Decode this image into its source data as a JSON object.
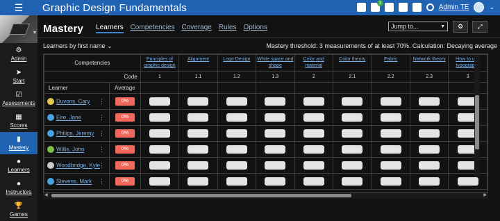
{
  "app": {
    "title": "Graphic Design Fundamentals"
  },
  "topbar": {
    "icons": [
      "mail-icon",
      "bell-icon",
      "calendar-icon",
      "trash-icon",
      "help-icon",
      "search-icon"
    ],
    "notification_count": "3",
    "user_name": "Admin TE",
    "caret": "⌄"
  },
  "sidebar": {
    "items": [
      {
        "label": "Admin",
        "icon": "⚙",
        "name": "admin"
      },
      {
        "label": "Start",
        "icon": "➤",
        "name": "start"
      },
      {
        "label": "Assessments",
        "icon": "☑",
        "name": "assessments"
      },
      {
        "label": "Scores",
        "icon": "▦",
        "name": "scores"
      },
      {
        "label": "Mastery",
        "icon": "▮",
        "name": "mastery"
      },
      {
        "label": "Learners",
        "icon": "●",
        "name": "learners"
      },
      {
        "label": "Instructors",
        "icon": "●",
        "name": "instructors"
      },
      {
        "label": "Games",
        "icon": "🏆",
        "name": "games"
      }
    ],
    "active": "Mastery"
  },
  "page": {
    "title": "Mastery",
    "tabs": [
      "Learners",
      "Competencies",
      "Coverage",
      "Rules",
      "Options"
    ],
    "active_tab": "Learners",
    "jump_to": "Jump to...",
    "learners_by": "Learners by first name",
    "threshold_text": "Mastery threshold: 3 measurements of at least 70%.   Calculation: Decaying average"
  },
  "table": {
    "corner_label": "Competencies",
    "code_label": "Code",
    "learner_header": "Learner",
    "average_header": "Average",
    "competencies": [
      {
        "name": "Principles of graphic design",
        "code": "1"
      },
      {
        "name": "Alignment",
        "code": "1.1"
      },
      {
        "name": "Logo Design",
        "code": "1.2"
      },
      {
        "name": "White space and shape",
        "code": "1.3"
      },
      {
        "name": "Color and material",
        "code": "2"
      },
      {
        "name": "Color theory",
        "code": "2.1"
      },
      {
        "name": "Fabric",
        "code": "2.2"
      },
      {
        "name": "Network theory",
        "code": "2.3"
      },
      {
        "name": "How to use typography",
        "code": "3"
      }
    ],
    "learners": [
      {
        "name": "Duvons, Cary",
        "average": "0%",
        "avatar_color": "#e0c64b"
      },
      {
        "name": "Eire, Jane",
        "average": "0%",
        "avatar_color": "#4aa3df"
      },
      {
        "name": "Philips, Jeremy",
        "average": "0%",
        "avatar_color": "#4aa3df"
      },
      {
        "name": "Willis, John",
        "average": "0%",
        "avatar_color": "#7cc04a"
      },
      {
        "name": "Woodbridge, Kyle",
        "average": "0%",
        "avatar_color": "#c9c9c9"
      },
      {
        "name": "Stevens, Mark",
        "average": "0%",
        "avatar_color": "#4aa3df"
      }
    ]
  },
  "colors": {
    "accent": "#1f63b2",
    "average_pill": "#f2685a",
    "link": "#79aee6"
  }
}
